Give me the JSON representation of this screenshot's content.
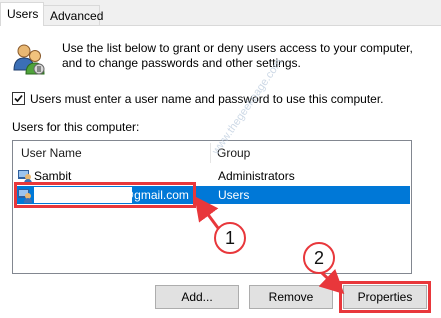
{
  "tabs": [
    {
      "label": "Users",
      "active": true
    },
    {
      "label": "Advanced",
      "active": false
    }
  ],
  "intro_text": "Use the list below to grant or deny users access to your computer, and to change passwords and other settings.",
  "require_login": {
    "label": "Users must enter a user name and password to use this computer.",
    "checked": true
  },
  "users_list": {
    "label": "Users for this computer:",
    "columns": [
      "User Name",
      "Group"
    ],
    "rows": [
      {
        "name": "Sambit",
        "group": "Administrators",
        "icon": "user-icon",
        "selected": false
      },
      {
        "name": "@gmail.com",
        "group": "Users",
        "icon": "user-icon",
        "selected": true
      }
    ]
  },
  "buttons": {
    "add": "Add...",
    "remove": "Remove",
    "properties": "Properties"
  },
  "annotations": {
    "step1": "1",
    "step2": "2",
    "color": "#e8373b"
  },
  "watermark": "www.thegeekpage.com",
  "colors": {
    "selection": "#0078d7",
    "highlight": "#e8373b"
  }
}
